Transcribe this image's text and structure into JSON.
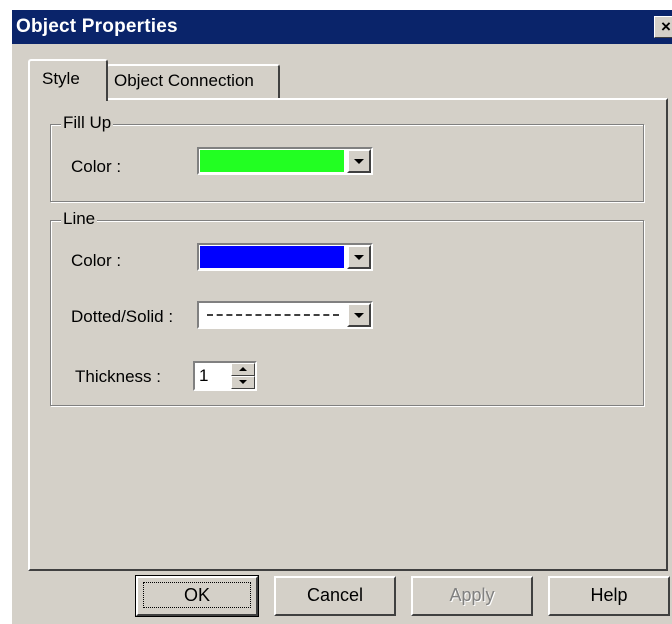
{
  "window": {
    "title": "Object Properties",
    "close_label": "×"
  },
  "tabs": [
    {
      "label": "Style",
      "selected": true
    },
    {
      "label": "Object Connection",
      "selected": false
    }
  ],
  "fill_up": {
    "group_label": "Fill Up",
    "color_label": "Color :",
    "color_value": "#22ff22"
  },
  "line": {
    "group_label": "Line",
    "color_label": "Color :",
    "color_value": "#0000ff",
    "style_label": "Dotted/Solid :",
    "style_value": "dotted",
    "thickness_label": "Thickness :",
    "thickness_value": "1"
  },
  "buttons": {
    "ok": "OK",
    "cancel": "Cancel",
    "apply": "Apply",
    "help": "Help"
  },
  "colors": {
    "titlebar": "#0a246a",
    "face": "#d4d0c8"
  }
}
